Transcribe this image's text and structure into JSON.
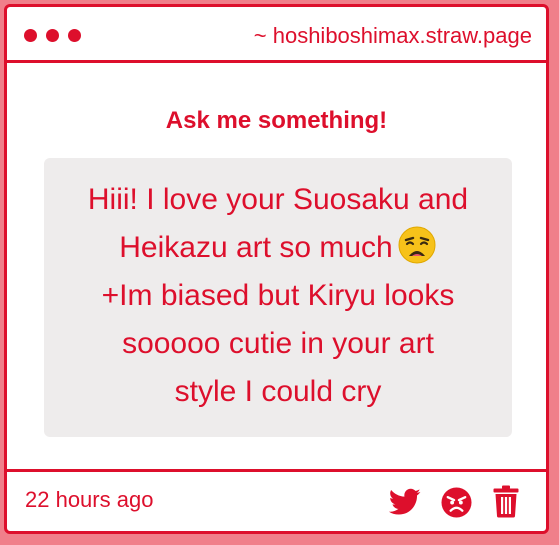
{
  "window": {
    "url": "~ hoshiboshimax.straw.page"
  },
  "main": {
    "heading": "Ask me something!",
    "question_lines": [
      "Hiii! I love your Suosaku and",
      "Heikazu art so much",
      "+Im biased but Kiryu looks",
      "sooooo cutie in your art",
      "style I could cry"
    ],
    "question_emoji": "weary-face-emoji"
  },
  "footer": {
    "timestamp": "22 hours ago",
    "actions": [
      "twitter-icon",
      "angry-face-icon",
      "trash-icon"
    ]
  },
  "colors": {
    "accent": "#dd0f2c",
    "page_background": "#f07f8a",
    "card_background": "#ffffff",
    "question_background": "#eeecec"
  }
}
